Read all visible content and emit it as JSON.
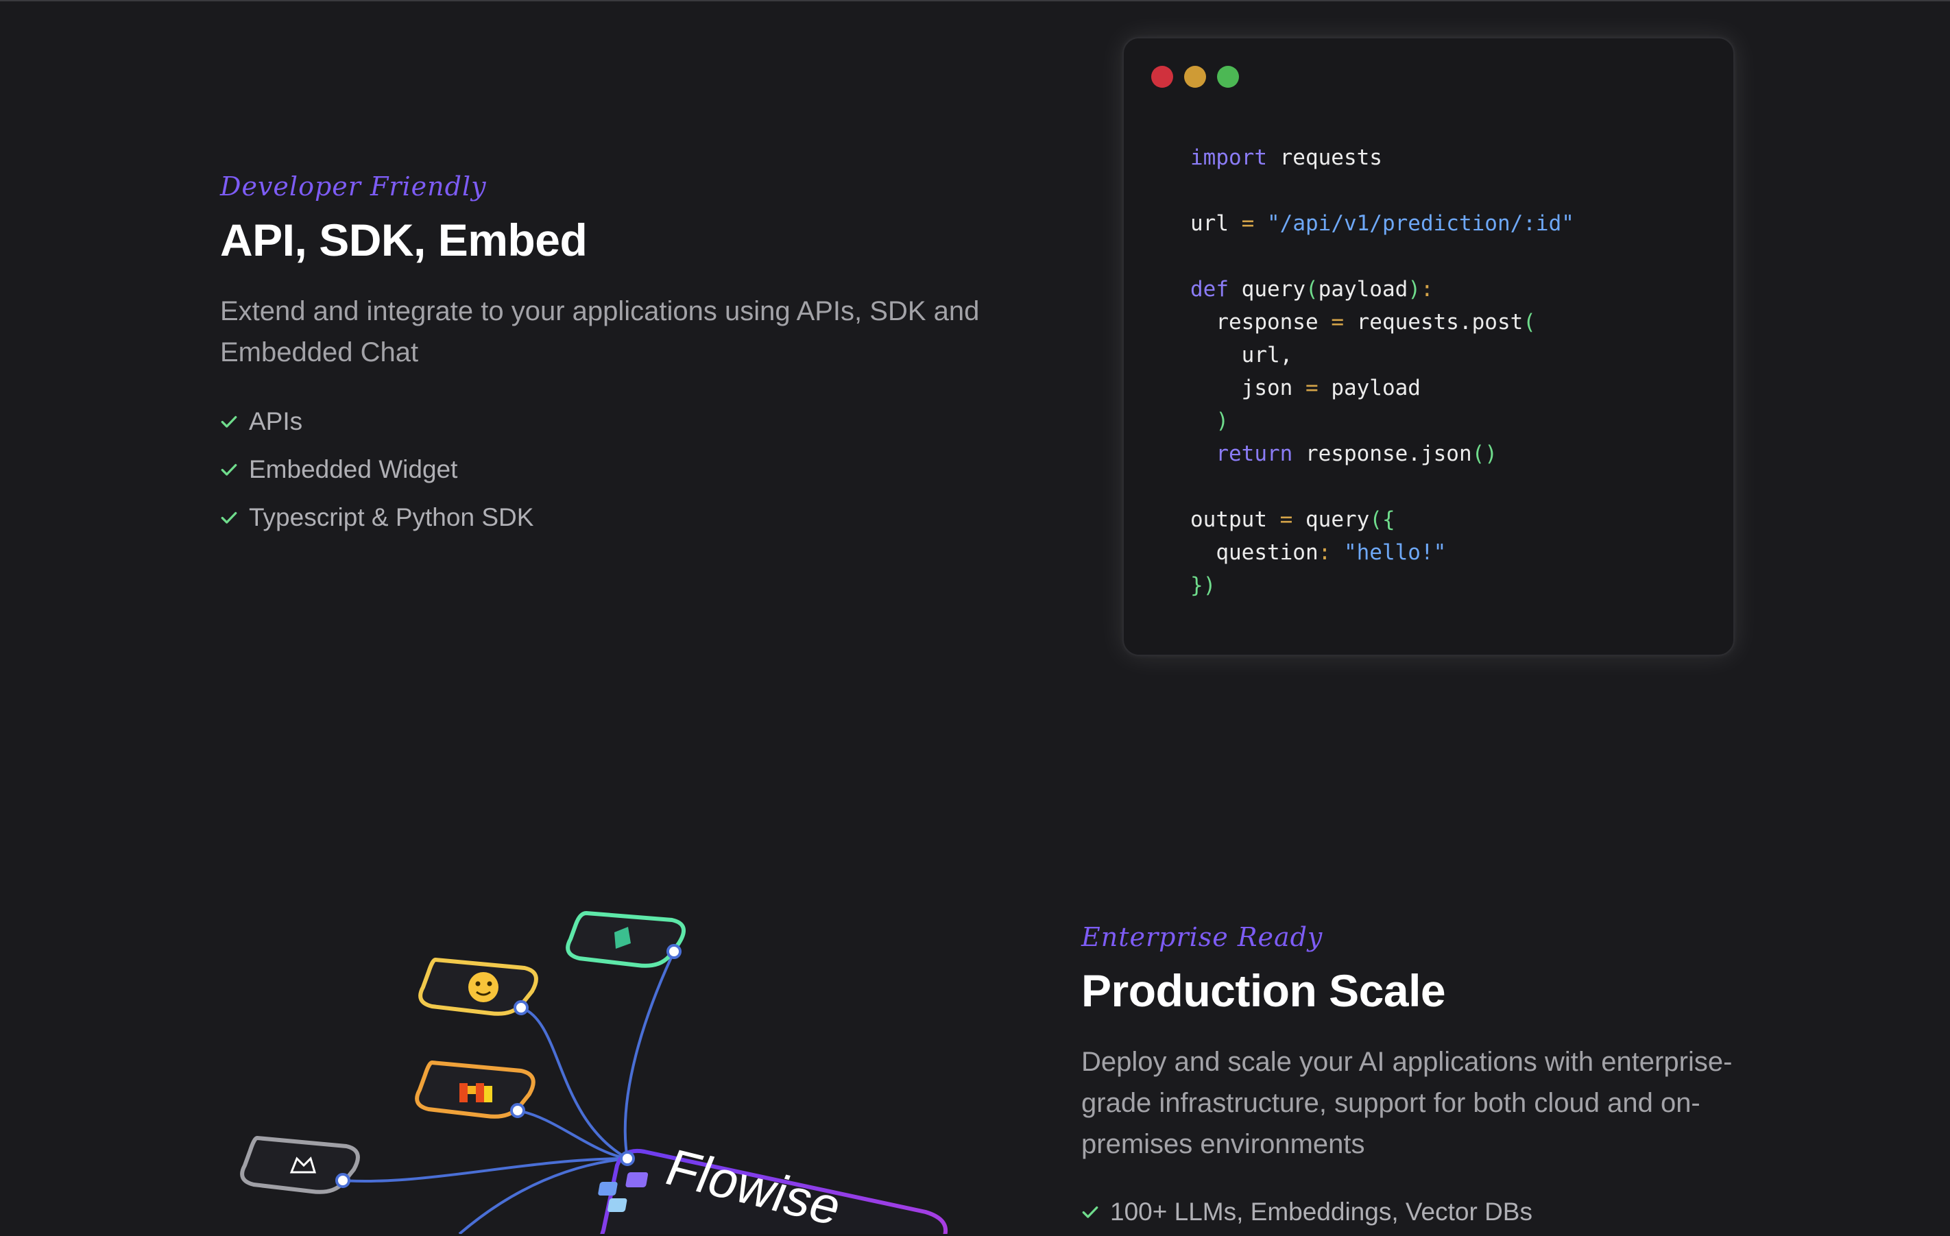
{
  "section_api": {
    "eyebrow": "Developer Friendly",
    "title": "API, SDK, Embed",
    "description": "Extend and integrate to your applications using APIs, SDK and Embedded Chat",
    "features": [
      "APIs",
      "Embedded Widget",
      "Typescript & Python SDK"
    ]
  },
  "code_window": {
    "dot_colors": [
      "#d0313d",
      "#cf9b35",
      "#4cb854"
    ],
    "language": "python",
    "lines": [
      "import requests",
      "",
      "url = \"/api/v1/prediction/:id\"",
      "",
      "def query(payload):",
      "  response = requests.post(",
      "    url,",
      "    json = payload",
      "  )",
      "  return response.json()",
      "",
      "output = query({",
      "  question: \"hello!\"",
      "})"
    ]
  },
  "section_scale": {
    "eyebrow": "Enterprise Ready",
    "title": "Production Scale",
    "description": "Deploy and scale your AI applications with enterprise-grade infrastructure, support for both cloud and on-premises environments",
    "features": [
      "100+ LLMs, Embeddings, Vector DBs"
    ]
  },
  "illustration": {
    "brand_label": "Flowise",
    "nodes": [
      "leaf-node-icon",
      "huggingface-icon",
      "mistral-icon",
      "llama-icon"
    ]
  },
  "colors": {
    "accent_purple": "#7d5cf5",
    "check_green": "#6fdc8c",
    "keyword": "#8b7cf6",
    "string": "#6ea8f7",
    "operator": "#d5a449",
    "paren": "#6fdc8c"
  }
}
